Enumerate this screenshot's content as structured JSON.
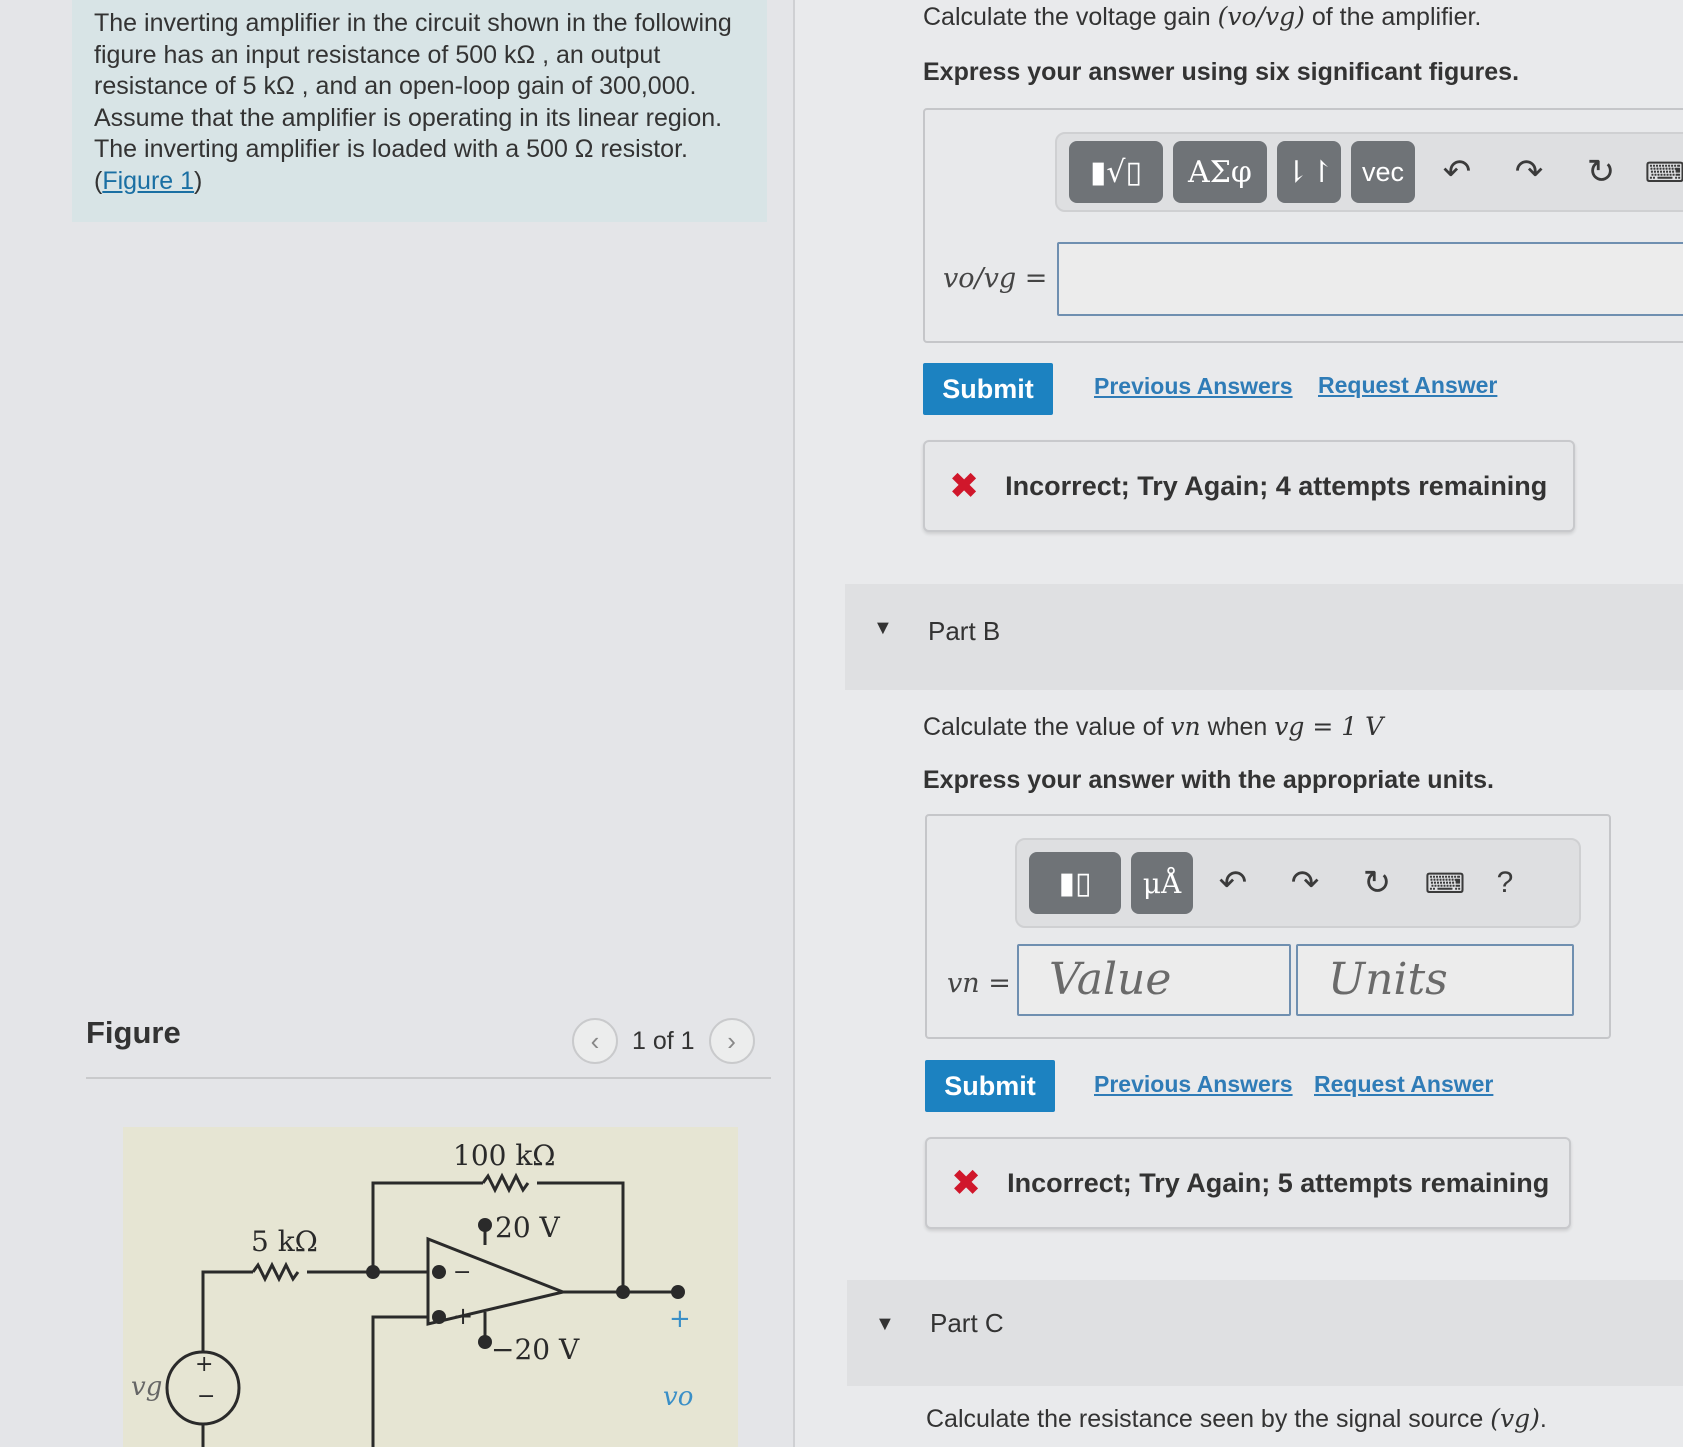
{
  "problem": {
    "text": "The inverting amplifier in the circuit shown in the following figure has an input resistance of 500 kΩ , an output resistance of 5 kΩ , and an open-loop gain of 300,000. Assume that the amplifier is operating in its linear region. The inverting amplifier is loaded with a 500 Ω resistor.(",
    "figure_link": "Figure 1",
    "closing": ")"
  },
  "figure": {
    "label": "Figure",
    "prev_icon": "chevron-left-icon",
    "next_icon": "chevron-right-icon",
    "page": "1 of 1",
    "circuit": {
      "r_feedback": "100 kΩ",
      "r_input": "5 kΩ",
      "v_pos": "20 V",
      "v_neg": "−20 V",
      "source": "vg",
      "output": "vo",
      "plus": "+",
      "minus": "−"
    }
  },
  "part_a": {
    "question_prefix": "Calculate the voltage gain ",
    "question_math": "(vo/vg)",
    "question_suffix": " of the amplifier.",
    "instruction": "Express your answer using six significant figures.",
    "toolbar": {
      "templates": "▮√▯",
      "greek": "ΑΣφ",
      "arrows": "⇂↾",
      "vec": "vec",
      "undo_icon": "undo-icon",
      "redo_icon": "redo-icon",
      "reset_icon": "reset-icon",
      "keyboard_icon": "keyboard-icon"
    },
    "eq_label": "vo/vg =",
    "input_value": "",
    "submit": "Submit",
    "previous_answers": "Previous Answers",
    "request_answer": "Request Answer",
    "feedback": "Incorrect; Try Again; 4 attempts remaining"
  },
  "part_b": {
    "title": "Part B",
    "question_prefix": "Calculate the value of ",
    "question_math": "vn",
    "question_mid": " when ",
    "question_math2": "vg = 1 V",
    "instruction": "Express your answer with the appropriate units.",
    "toolbar": {
      "templates": "▮▯",
      "units": "μÅ",
      "help": "?"
    },
    "eq_label": "vn =",
    "value_placeholder": "Value",
    "units_placeholder": "Units",
    "submit": "Submit",
    "previous_answers": "Previous Answers",
    "request_answer": "Request Answer",
    "feedback": "Incorrect; Try Again; 5 attempts remaining"
  },
  "part_c": {
    "title": "Part C",
    "question_prefix": "Calculate the resistance seen by the signal source ",
    "question_math": "(vg)",
    "question_suffix": "."
  },
  "colors": {
    "accent": "#1c82c1",
    "link": "#2f7cb7",
    "error": "#d0172b",
    "problem_bg": "#d8e4e6"
  }
}
